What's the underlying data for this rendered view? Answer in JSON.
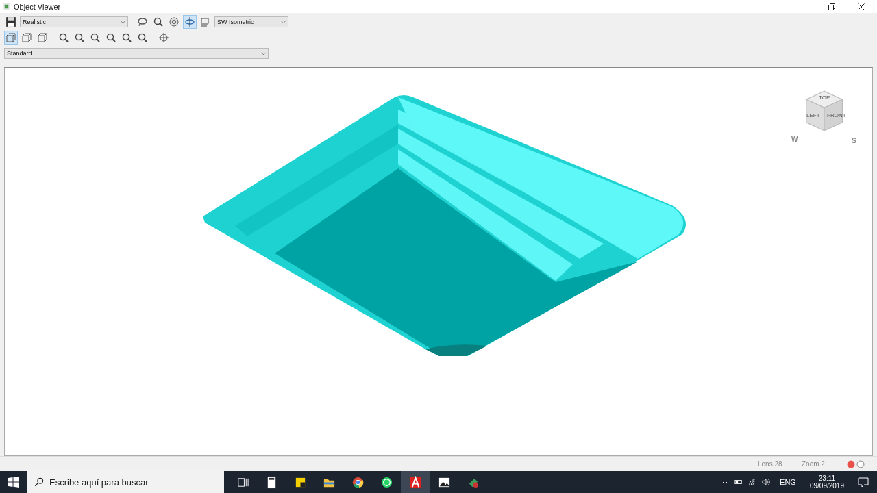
{
  "window": {
    "title": "Object Viewer"
  },
  "toolbar": {
    "visual_style": "Realistic",
    "view": "SW Isometric",
    "tools": [
      {
        "kind": "lasso",
        "selected": false
      },
      {
        "kind": "zoom",
        "selected": false
      },
      {
        "kind": "steering",
        "selected": false
      },
      {
        "kind": "orbit",
        "selected": true
      },
      {
        "kind": "camera",
        "selected": false
      }
    ]
  },
  "toolbar2": {
    "tools": [
      {
        "kind": "box",
        "selected": true
      },
      {
        "kind": "box",
        "selected": false
      },
      {
        "kind": "box",
        "selected": false
      },
      {
        "kind": "zoom",
        "selected": false
      },
      {
        "kind": "zoom",
        "selected": false
      },
      {
        "kind": "zoom",
        "selected": false
      },
      {
        "kind": "zoom",
        "selected": false
      },
      {
        "kind": "zoom",
        "selected": false
      },
      {
        "kind": "zoom",
        "selected": false
      },
      {
        "kind": "target",
        "selected": false
      }
    ]
  },
  "ucs": "Standard",
  "viewcube": {
    "faces": [
      "TOP",
      "LEFT",
      "FRONT"
    ],
    "compass": [
      "W",
      "S"
    ]
  },
  "status_bar": {
    "lens": "Lens 28",
    "zoom": "Zoom 2"
  },
  "taskbar": {
    "search": {
      "placeholder": "Escribe aquí para buscar"
    },
    "apps": [
      {
        "kind": "taskview",
        "selected": false
      },
      {
        "kind": "calculator",
        "selected": false
      },
      {
        "kind": "notes",
        "selected": false
      },
      {
        "kind": "folder",
        "selected": false
      },
      {
        "kind": "chrome",
        "selected": false
      },
      {
        "kind": "whatsapp",
        "selected": false
      },
      {
        "kind": "autocad",
        "selected": true
      },
      {
        "kind": "photos",
        "selected": false
      },
      {
        "kind": "app",
        "selected": false
      }
    ],
    "tray": {
      "language": "ENG",
      "time": "23:11",
      "date": "09/09/2019"
    }
  }
}
